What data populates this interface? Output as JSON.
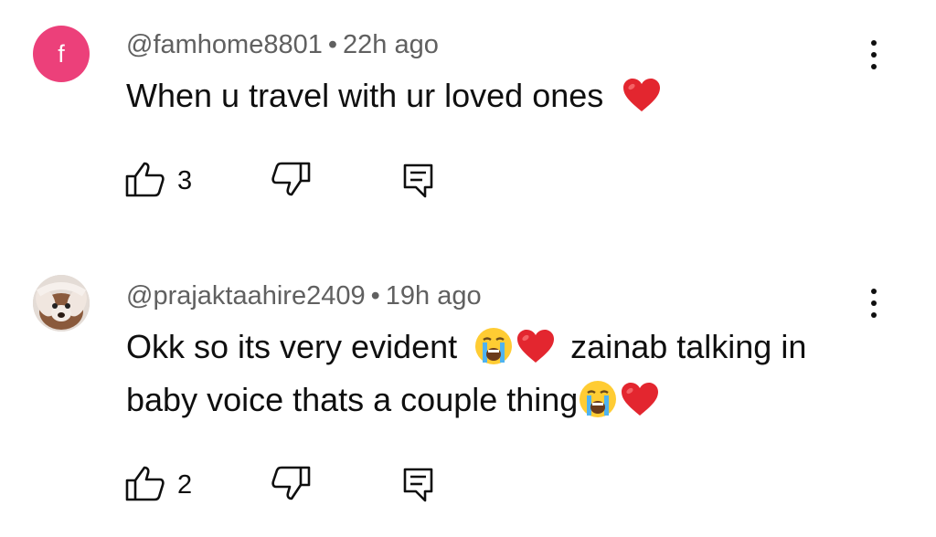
{
  "comments": [
    {
      "avatar_letter": "f",
      "avatar_color": "#ec407a",
      "username": "@famhome8801",
      "separator": "•",
      "time": "22h ago",
      "text_line1": "When u travel with ur loved ones",
      "like_count": "3",
      "icons": [
        "thumb-up-icon",
        "thumb-down-icon",
        "reply-icon",
        "more-vert-icon",
        "red-heart-emoji"
      ]
    },
    {
      "avatar_image": "dog photo",
      "username": "@prajaktaahire2409",
      "separator": "•",
      "time": "19h ago",
      "text_line1a": "Okk so its very evident",
      "text_line1b": "zainab talking in",
      "text_line2": "baby voice thats a couple thing",
      "like_count": "2",
      "icons": [
        "thumb-up-icon",
        "thumb-down-icon",
        "reply-icon",
        "more-vert-icon",
        "crying-face-emoji",
        "red-heart-emoji"
      ]
    }
  ],
  "colors": {
    "text": "#0f0f0f",
    "meta": "#606060",
    "heart": "#e3262f",
    "background": "#ffffff"
  }
}
